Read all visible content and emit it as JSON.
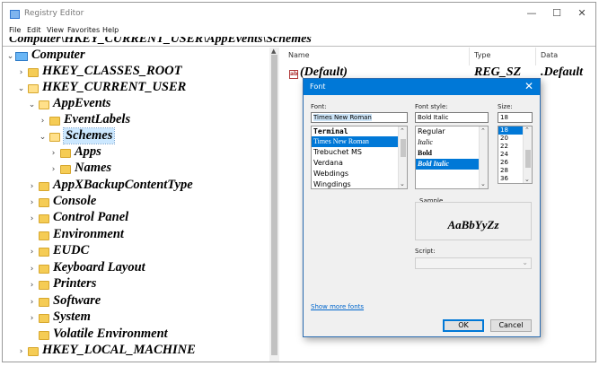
{
  "window": {
    "title": "Registry Editor",
    "controls": {
      "minimize": "—",
      "maximize": "☐",
      "close": "✕"
    }
  },
  "menu": [
    "File",
    "Edit",
    "View",
    "Favorites",
    "Help"
  ],
  "address": "Computer\\HKEY_CURRENT_USER\\AppEvents\\Schemes",
  "tree": {
    "root": "Computer",
    "hkcr": "HKEY_CLASSES_ROOT",
    "hkcu": "HKEY_CURRENT_USER",
    "appevents": "AppEvents",
    "eventlabels": "EventLabels",
    "schemes": "Schemes",
    "apps": "Apps",
    "names": "Names",
    "appx": "AppXBackupContentType",
    "console": "Console",
    "control_panel": "Control Panel",
    "environment": "Environment",
    "eudc": "EUDC",
    "keyboard": "Keyboard Layout",
    "printers": "Printers",
    "software": "Software",
    "system": "System",
    "volatile": "Volatile Environment",
    "hklm": "HKEY_LOCAL_MACHINE"
  },
  "list": {
    "columns": {
      "name": "Name",
      "type": "Type",
      "data": "Data"
    },
    "row": {
      "name": "(Default)",
      "type": "REG_SZ",
      "data": ".Default"
    },
    "icon_text": "ab"
  },
  "font_dialog": {
    "title": "Font",
    "close": "✕",
    "font_label": "Font:",
    "font_value": "Times New Roman",
    "fonts": [
      "Terminal",
      "Times New Roman",
      "Trebuchet MS",
      "Verdana",
      "Webdings",
      "Wingdings"
    ],
    "style_label": "Font style:",
    "style_value": "Bold Italic",
    "styles": [
      "Regular",
      "Italic",
      "Bold",
      "Bold Italic"
    ],
    "size_label": "Size:",
    "size_value": "18",
    "sizes": [
      "18",
      "20",
      "22",
      "24",
      "26",
      "28",
      "36"
    ],
    "sample_label": "Sample",
    "sample_text": "AaBbYyZz",
    "script_label": "Script:",
    "script_value": "",
    "more_fonts": "Show more fonts",
    "ok": "OK",
    "cancel": "Cancel"
  },
  "colors": {
    "accent": "#0078d7",
    "folder": "#f5cc55",
    "tree_selection": "#cce8ff"
  }
}
